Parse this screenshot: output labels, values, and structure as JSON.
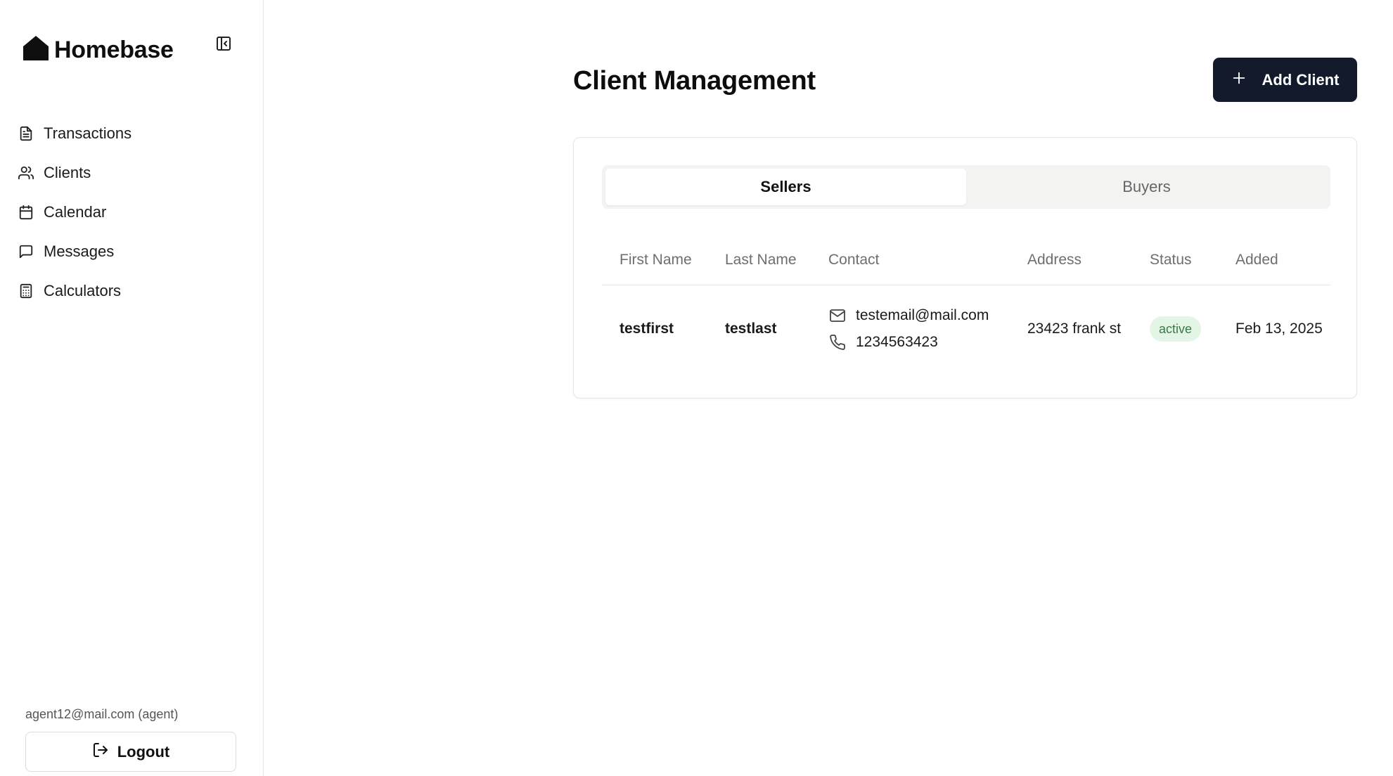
{
  "app": {
    "name": "Homebase"
  },
  "sidebar": {
    "items": [
      {
        "label": "Transactions",
        "icon": "file-text-icon"
      },
      {
        "label": "Clients",
        "icon": "users-icon"
      },
      {
        "label": "Calendar",
        "icon": "calendar-icon"
      },
      {
        "label": "Messages",
        "icon": "message-square-icon"
      },
      {
        "label": "Calculators",
        "icon": "calculator-icon"
      }
    ],
    "user_email": "agent12@mail.com (agent)",
    "logout_label": "Logout"
  },
  "main": {
    "title": "Client Management",
    "add_button_label": "Add Client",
    "tabs": [
      {
        "label": "Sellers",
        "active": true
      },
      {
        "label": "Buyers",
        "active": false
      }
    ],
    "table": {
      "headers": [
        "First Name",
        "Last Name",
        "Contact",
        "Address",
        "Status",
        "Added"
      ],
      "rows": [
        {
          "first_name": "testfirst",
          "last_name": "testlast",
          "email": "testemail@mail.com",
          "phone": "1234563423",
          "address": "23423 frank st",
          "status": "active",
          "added": "Feb 13, 2025"
        }
      ]
    }
  },
  "colors": {
    "primary_button": "#121a2b",
    "status_active_bg": "#e3f6e6",
    "status_active_text": "#3a7a45",
    "tab_track": "#f3f3f2"
  }
}
